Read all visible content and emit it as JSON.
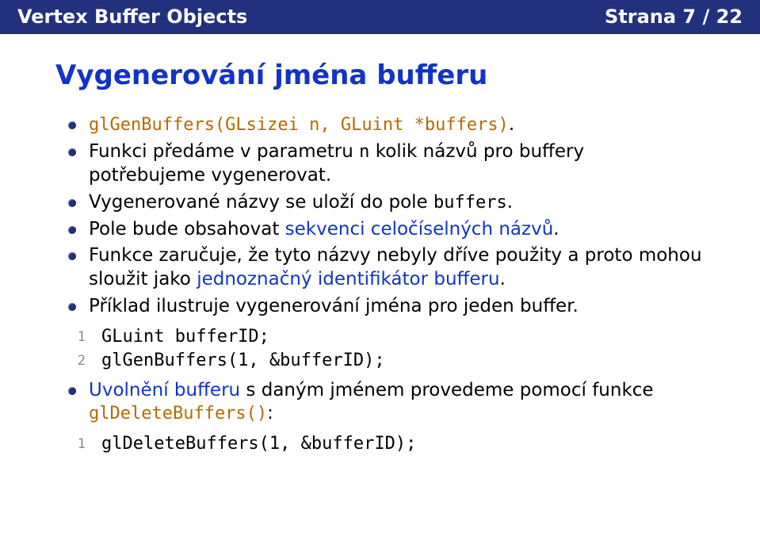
{
  "header": {
    "left": "Vertex Buffer Objects",
    "right": "Strana 7 / 22"
  },
  "title": "Vygenerování jména bufferu",
  "bullets": {
    "b1": "glGenBuffers(GLsizei n, GLuint *buffers)",
    "b1_dot": ".",
    "b2a": "Funkci předáme v parametru ",
    "b2n": "n",
    "b2b": " kolik názvů pro buffery potřebujeme vygenerovat.",
    "b3a": "Vygenerované názvy se uloží do pole ",
    "b3buf": "buffers",
    "b3b": ".",
    "b4a": "Pole bude obsahovat ",
    "b4seq": "sekvenci celočíselných názvů",
    "b4b": ".",
    "b5a": "Funkce zaručuje, že tyto názvy nebyly dříve použity a proto mohou sloužit jako ",
    "b5id": "jednoznačný identifikátor bufferu",
    "b5b": ".",
    "b6": "Příklad ilustruje vygenerování jména pro jeden buffer.",
    "b7a": "Uvolnění bufferu",
    "b7b": " s daným jménem provedeme pomocí funkce ",
    "b7fn": "glDeleteBuffers()",
    "b7c": ":"
  },
  "code1": {
    "n1": "1",
    "l1": "GLuint bufferID;",
    "n2": "2",
    "l2": "glGenBuffers(1, &bufferID);"
  },
  "code2": {
    "n1": "1",
    "l1": "glDeleteBuffers(1, &bufferID);"
  }
}
